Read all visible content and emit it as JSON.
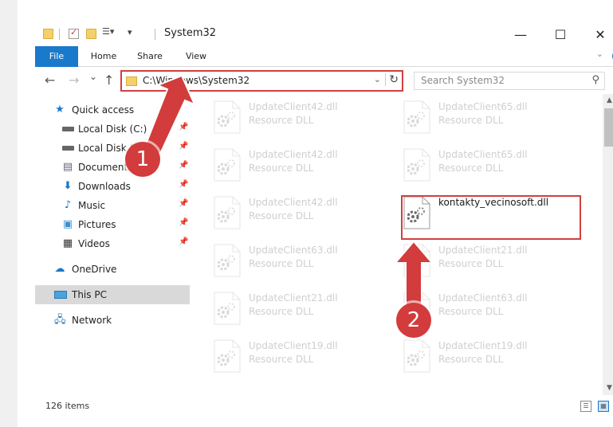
{
  "window": {
    "title": "System32",
    "minimize": "—",
    "maximize": "☐",
    "close": "✕"
  },
  "ribbon": {
    "tabs": [
      "File",
      "Home",
      "Share",
      "View"
    ]
  },
  "nav": {
    "back": "←",
    "forward": "→",
    "recent": "⌄",
    "up": "↑",
    "address": "C:\\Windows\\System32",
    "search_placeholder": "Search System32"
  },
  "sidebar": {
    "items": [
      {
        "label": "Quick access",
        "icon": "star-icon",
        "pinned": false
      },
      {
        "label": "Local Disk (C:)",
        "icon": "drive-icon",
        "pinned": true
      },
      {
        "label": "Local Disk (D:)",
        "icon": "drive-icon",
        "pinned": true
      },
      {
        "label": "Documents",
        "icon": "document-icon",
        "pinned": true
      },
      {
        "label": "Downloads",
        "icon": "download-icon",
        "pinned": true
      },
      {
        "label": "Music",
        "icon": "music-icon",
        "pinned": true
      },
      {
        "label": "Pictures",
        "icon": "picture-icon",
        "pinned": true
      },
      {
        "label": "Videos",
        "icon": "video-icon",
        "pinned": true
      },
      {
        "label": "OneDrive",
        "icon": "cloud-icon",
        "pinned": false
      },
      {
        "label": "This PC",
        "icon": "computer-icon",
        "pinned": false,
        "selected": true
      },
      {
        "label": "Network",
        "icon": "network-icon",
        "pinned": false
      }
    ]
  },
  "files": [
    {
      "name": "UpdateClient42.dll",
      "type": "Resource DLL",
      "faded": true
    },
    {
      "name": "UpdateClient65.dll",
      "type": "Resource DLL",
      "faded": true
    },
    {
      "name": "UpdateClient42.dll",
      "type": "Resource DLL",
      "faded": true
    },
    {
      "name": "UpdateClient65.dll",
      "type": "Resource DLL",
      "faded": true
    },
    {
      "name": "UpdateClient42.dll",
      "type": "Resource DLL",
      "faded": true
    },
    {
      "name": "kontakty_vecinosoft.dll",
      "type": "",
      "faded": false
    },
    {
      "name": "UpdateClient63.dll",
      "type": "Resource DLL",
      "faded": true
    },
    {
      "name": "UpdateClient21.dll",
      "type": "Resource DLL",
      "faded": true
    },
    {
      "name": "UpdateClient21.dll",
      "type": "Resource DLL",
      "faded": true
    },
    {
      "name": "UpdateClient63.dll",
      "type": "Resource DLL",
      "faded": true
    },
    {
      "name": "UpdateClient19.dll",
      "type": "Resource DLL",
      "faded": true
    },
    {
      "name": "UpdateClient19.dll",
      "type": "Resource DLL",
      "faded": true
    }
  ],
  "status": {
    "items_count": "126 items"
  },
  "callouts": [
    "1",
    "2"
  ],
  "colors": {
    "accent": "#1979ca",
    "highlight": "#d04040",
    "callout": "#d23c3c"
  }
}
